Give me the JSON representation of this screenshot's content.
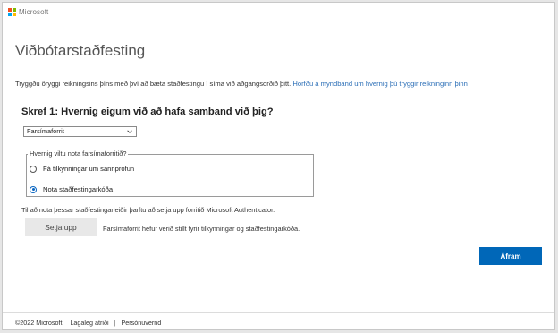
{
  "header": {
    "brand": "Microsoft",
    "logo_colors": [
      "#f25022",
      "#7fba00",
      "#00a4ef",
      "#ffb900"
    ]
  },
  "page": {
    "title": "Viðbótarstaðfesting",
    "intro_text": "Tryggðu öryggi reikningsins þíns með því að bæta staðfestingu í síma við aðgangsorðið þitt. ",
    "intro_link": "Horfðu á myndband um hvernig þú tryggir reikninginn þinn"
  },
  "step1": {
    "heading": "Skref 1: Hvernig eigum við að hafa samband við þig?",
    "method_select_value": "Farsímaforrit",
    "legend": "Hvernig viltu nota farsímaforritið?",
    "options": [
      {
        "label": "Fá tilkynningar um sannprófun",
        "selected": false
      },
      {
        "label": "Nota staðfestingarkóða",
        "selected": true
      }
    ],
    "note": "Til að nota þessar staðfestingarleiðir þarftu að setja upp forritið Microsoft Authenticator.",
    "setup_button": "Setja upp",
    "setup_status": "Farsímaforrit hefur verið stillt fyrir tilkynningar og staðfestingarkóða."
  },
  "actions": {
    "next_button": "Áfram"
  },
  "footer": {
    "copyright": "©2022 Microsoft",
    "legal": "Lagaleg atriði",
    "separator": "|",
    "privacy": "Persónuvernd"
  },
  "colors": {
    "accent": "#0067b8",
    "link": "#2c6fb7"
  }
}
